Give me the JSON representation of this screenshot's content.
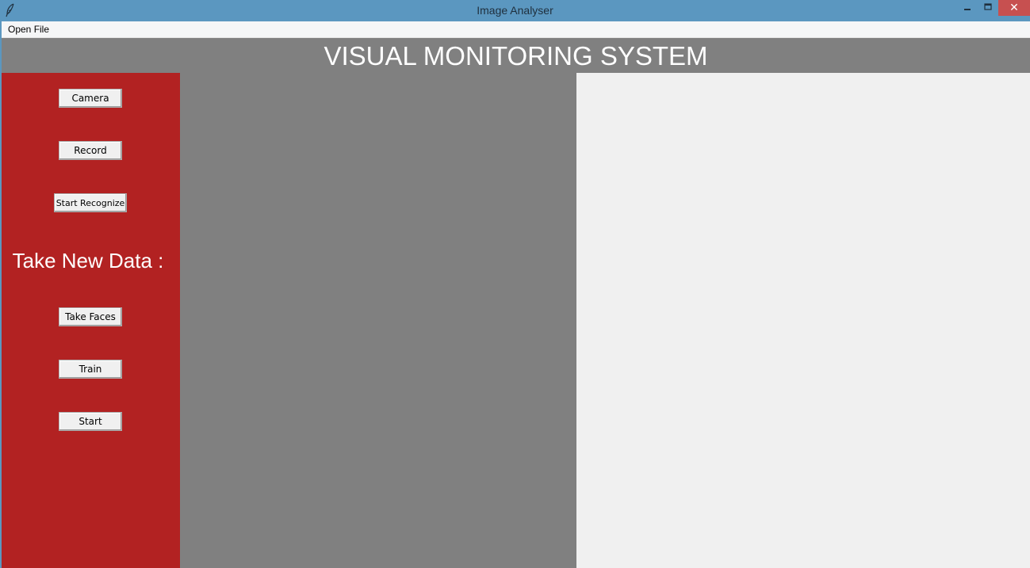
{
  "window": {
    "title": "Image Analyser",
    "icon": "feather-icon",
    "controls": [
      "minimize-icon",
      "maximize-icon",
      "close-icon"
    ],
    "close_glyph": "✕"
  },
  "menubar": {
    "items": [
      {
        "label": "Open File"
      }
    ]
  },
  "header": {
    "title": "VISUAL MONITORING SYSTEM"
  },
  "sidebar": {
    "buttons_top": [
      {
        "label": "Camera"
      },
      {
        "label": "Record"
      },
      {
        "label": "Start Recognize"
      }
    ],
    "section_label": "Take New Data :",
    "buttons_bottom": [
      {
        "label": "Take Faces"
      },
      {
        "label": "Train"
      },
      {
        "label": "Start"
      }
    ]
  },
  "colors": {
    "titlebar": "#5b97c0",
    "sidebar": "#b22222",
    "header": "#808080",
    "video_panel": "#808080",
    "result_panel": "#f0f0f0",
    "close_button": "#c75050"
  }
}
